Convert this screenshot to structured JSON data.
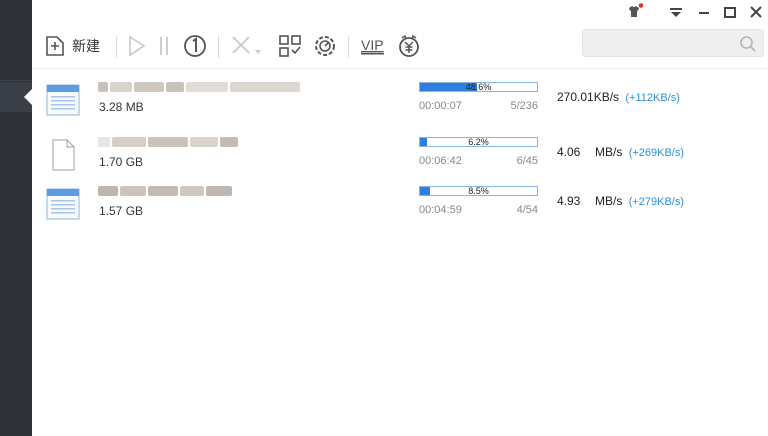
{
  "window": {
    "skin_icon": "shirt-icon",
    "menu_icon": "menu-dropdown-icon",
    "minimize_icon": "minimize-icon",
    "maximize_icon": "maximize-icon",
    "close_icon": "close-icon"
  },
  "toolbar": {
    "new_label": "新建",
    "vip_label": "VIP",
    "search_placeholder": ""
  },
  "colors": {
    "sidebar": "#2f3238",
    "progress_fill": "#2e7fdb",
    "speed_up": "#2a8fd8"
  },
  "downloads": [
    {
      "icon": "webpage-file-icon",
      "size": "3.28 MB",
      "percent_label": "48.6%",
      "percent": 48.6,
      "elapsed": "00:00:07",
      "chunks": "5/236",
      "speed_num": "270.01",
      "speed_unit": "KB/s",
      "speed_delta": "(+112KB/s)"
    },
    {
      "icon": "blank-file-icon",
      "size": "1.70 GB",
      "percent_label": "6.2%",
      "percent": 6.2,
      "elapsed": "00:06:42",
      "chunks": "6/45",
      "speed_num": "4.06",
      "speed_unit": "MB/s",
      "speed_delta": "(+269KB/s)"
    },
    {
      "icon": "webpage-file-icon",
      "size": "1.57 GB",
      "percent_label": "8.5%",
      "percent": 8.5,
      "elapsed": "00:04:59",
      "chunks": "4/54",
      "speed_num": "4.93",
      "speed_unit": "MB/s",
      "speed_delta": "(+279KB/s)"
    }
  ]
}
